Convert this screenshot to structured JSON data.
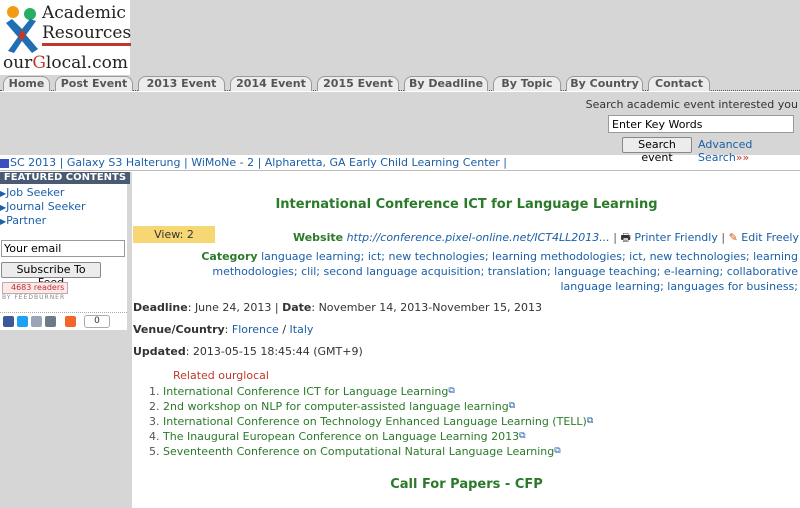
{
  "logo": {
    "line1": "Academic",
    "line2": "Resources",
    "line3_pre": "our",
    "line3_g": "G",
    "line3_post": "local.com"
  },
  "nav": {
    "tabs": [
      "Home",
      "Post Event",
      "2013 Event",
      "2014 Event",
      "2015 Event",
      "By Deadline",
      "By Topic",
      "By Country",
      "Contact"
    ]
  },
  "search": {
    "label": "Search academic event interested you",
    "value": "Enter Key Words",
    "button": "Search event",
    "advanced": "Advanced Search",
    "advanced_chev": "»»"
  },
  "ticker": {
    "text": "SC 2013 | Galaxy S3 Halterung | WiMoNe - 2 | Alpharetta, GA Early Child Learning Center |"
  },
  "sidebar": {
    "header": "FEATURED CONTENTS",
    "links": [
      "Job Seeker",
      "Journal Seeker",
      "Partner"
    ],
    "email_value": "Your email",
    "subscribe": "Subscribe To Feed",
    "readers": "4683 readers",
    "feedburner": "BY FEEDBURNER",
    "share_count": "0"
  },
  "event": {
    "title": "International Conference ICT for Language Learning",
    "views": "View: 2",
    "website_label": "Website",
    "website_url": "http://conference.pixel-online.net/ICT4LL2013...",
    "printer": "Printer Friendly",
    "edit": "Edit Freely",
    "category_label": "Category",
    "categories": "language learning; ict; new technologies; learning methodologies; ict, new technologies; learning methodologies; clil; second language acquisition; translation; language teaching; e-learning; collaborative language learning; languages for business;",
    "deadline_label": "Deadline",
    "deadline": "June 24, 2013",
    "date_label": "Date",
    "date": "November 14, 2013-November 15, 2013",
    "venue_label": "Venue/Country",
    "venue_city": "Florence",
    "venue_country": "Italy",
    "updated_label": "Updated",
    "updated": "2013-05-15 18:45:44 (GMT+9)"
  },
  "related": {
    "heading": "Related ourglocal",
    "items": [
      "International Conference ICT for Language Learning",
      "2nd workshop on NLP for computer-assisted language learning",
      "International Conference on Technology Enhanced Language Learning (TELL)",
      "The Inaugural European Conference on Language Learning 2013",
      "Seventeenth Conference on Computational Natural Language Learning"
    ]
  },
  "cfp": {
    "heading": "Call For Papers - CFP"
  },
  "colors": {
    "title_green": "#2a7a2a",
    "link_blue": "#1a5fa8",
    "accent_red": "#c0392b",
    "badge_yellow": "#f7d774",
    "sidebar_gray": "#d6d6d6",
    "featured_header": "#4a5a73"
  }
}
